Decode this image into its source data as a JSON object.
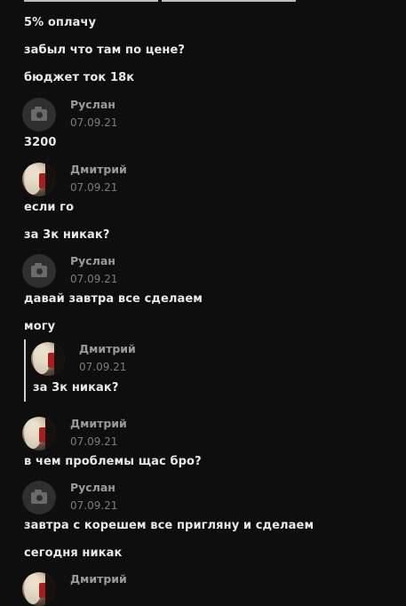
{
  "feed": {
    "lines": [
      "5% оплачу",
      "забыл что там по цене?",
      "бюджет ток 18к",
      "3200",
      "если го",
      "за 3к никак?",
      "давай завтра все сделаем",
      "могу",
      "в чем проблемы щас бро?",
      "завтра с корешем все пригляну и сделаем",
      "сегодня никак"
    ],
    "authors": {
      "ruslan": "Руслан",
      "dmitry": "Дмитрий"
    },
    "date": "07.09.21",
    "quote": {
      "author": "Дмитрий",
      "date": "07.09.21",
      "text": "за 3к никак?"
    }
  },
  "icons": {
    "no_photo_avatar": "camera-icon",
    "user_photo": "avatar-photo"
  },
  "colors": {
    "background": "#0e0e0e",
    "text": "#e8e8e8",
    "author": "#9a9a9a",
    "date": "#7b7b7b",
    "quote_bar": "#d0d0d0"
  }
}
